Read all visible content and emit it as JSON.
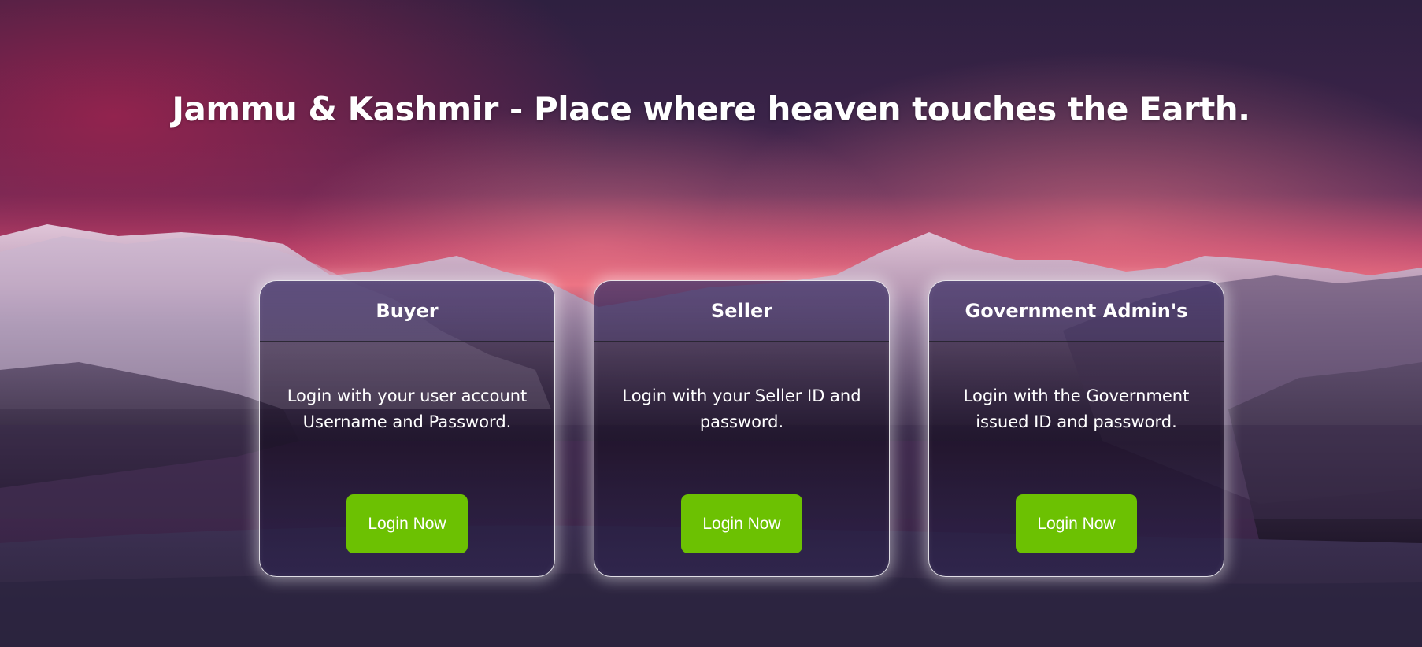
{
  "hero": {
    "headline": "Jammu & Kashmir - Place where heaven touches the Earth."
  },
  "colors": {
    "button": "#6cc102",
    "sky_top": "#2d1f3d",
    "sunset_glow": "#f26b7c",
    "card_border": "#ffffff"
  },
  "cards": [
    {
      "title": "Buyer",
      "description": "Login with your user account Username and Password.",
      "button_label": "Login Now"
    },
    {
      "title": "Seller",
      "description": "Login with your Seller ID and password.",
      "button_label": "Login Now"
    },
    {
      "title": "Government Admin's",
      "description": "Login with the Government issued ID and password.",
      "button_label": "Login Now"
    }
  ]
}
